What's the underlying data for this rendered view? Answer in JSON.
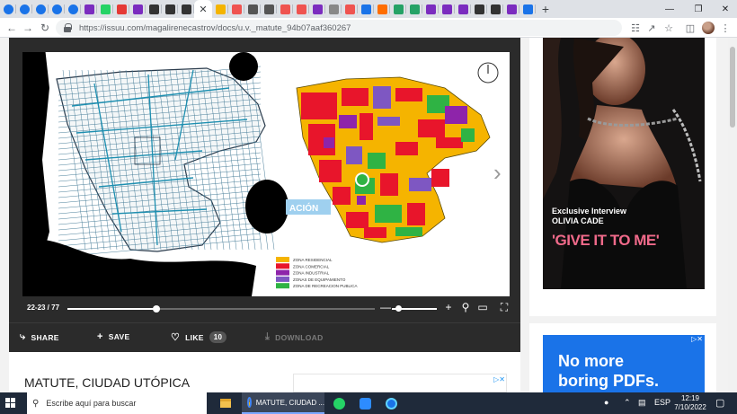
{
  "browser": {
    "tabs_count": 32,
    "active_tab_index": 12,
    "url": "https://issuu.com/magalirenecastrov/docs/u.v._matute_94b07aaf360267",
    "new_tab_label": "+"
  },
  "viewer": {
    "page_indicator": "22-23 / 77",
    "progress": 0.29,
    "zoom_level": 0.08,
    "map_label": "ACIÓN",
    "legend": [
      {
        "label": "ZONA RESIDENCIAL",
        "color": "#f5b400"
      },
      {
        "label": "ZONA COMERCIAL",
        "color": "#e8152b"
      },
      {
        "label": "ZONA INDUSTRIAL",
        "color": "#8e24aa"
      },
      {
        "label": "ZONAS DE EQUIPAMIENTO",
        "color": "#7e57c2"
      },
      {
        "label": "ZONA DE RECREACION PUBLICA",
        "color": "#2fb344"
      }
    ]
  },
  "actions": {
    "share": "SHARE",
    "save": "SAVE",
    "like": "LIKE",
    "like_count": "10",
    "download": "DOWNLOAD"
  },
  "document": {
    "title": "MATUTE, CIUDAD UTÓPICA"
  },
  "sidebar_ad": {
    "kicker": "Exclusive Interview",
    "name": "OLIVIA CADE",
    "headline": "'GIVE IT TO ME'"
  },
  "sidebar_ad2": {
    "line1": "No more",
    "line2": "boring PDFs."
  },
  "taskbar": {
    "search_placeholder": "Escribe aquí para buscar",
    "active_app_label": "MATUTE, CIUDAD ...",
    "language": "ESP",
    "time": "12:19",
    "date": "7/10/2022"
  },
  "colors": {
    "viewer_bg": "#2b2b2b",
    "ad2_bg": "#1a73e8",
    "taskbar_bg": "#1f2a3a"
  }
}
